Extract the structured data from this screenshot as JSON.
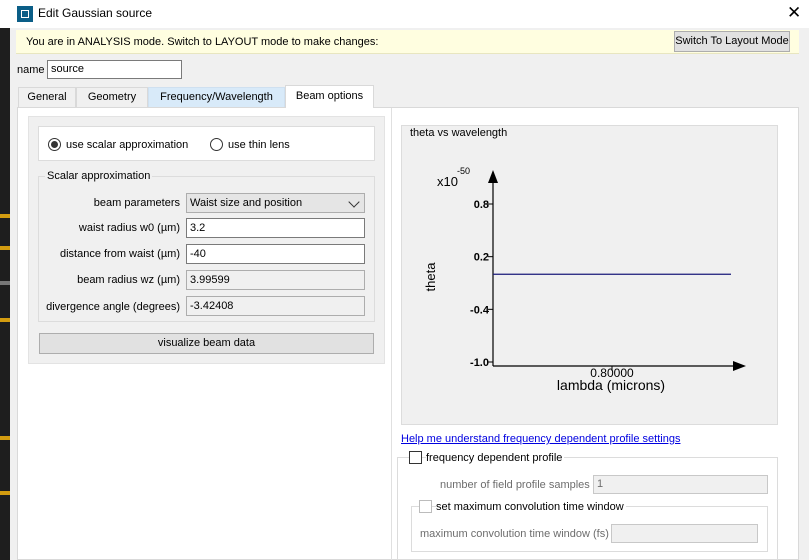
{
  "window": {
    "title": "Edit Gaussian source"
  },
  "infobar": {
    "message": "You are in ANALYSIS mode.  Switch to LAYOUT mode to make changes:",
    "switch_button": "Switch To Layout Mode"
  },
  "name_field": {
    "label": "name",
    "value": "source"
  },
  "tabs": [
    {
      "label": "General"
    },
    {
      "label": "Geometry"
    },
    {
      "label": "Frequency/Wavelength"
    },
    {
      "label": "Beam options"
    }
  ],
  "beam_options": {
    "radios": [
      {
        "label": "use scalar approximation",
        "checked": true
      },
      {
        "label": "use thin lens",
        "checked": false
      }
    ],
    "scalar_group": {
      "title": "Scalar approximation",
      "beam_parameters": {
        "label": "beam parameters",
        "value": "Waist size and position"
      },
      "waist_radius": {
        "label": "waist radius w0 (µm)",
        "value": "3.2"
      },
      "distance_from_waist": {
        "label": "distance from waist (µm)",
        "value": "-40"
      },
      "beam_radius": {
        "label": "beam radius wz (µm)",
        "value": "3.99599"
      },
      "divergence_angle": {
        "label": "divergence angle (degrees)",
        "value": "-3.42408"
      }
    },
    "visualize_button": "visualize beam data"
  },
  "chart_data": {
    "type": "line",
    "title": "theta vs wavelength",
    "xlabel": "lambda (microns)",
    "ylabel": "theta",
    "y_multiplier": "x10",
    "y_exponent": "-50",
    "y_ticks": [
      "0.8",
      "0.2",
      "-0.4",
      "-1.0"
    ],
    "x_ticks": [
      "0.80000"
    ],
    "series": [
      {
        "x": [
          0.75,
          0.85
        ],
        "y": [
          0,
          0
        ],
        "color": "#1a1a7a"
      }
    ],
    "colors": {
      "line": "#1a1a7a",
      "axes": "#000000"
    }
  },
  "help_link": "Help me understand frequency dependent profile settings",
  "frequency_profile": {
    "checkbox_label": "frequency dependent profile",
    "checked": false,
    "samples_label": "number of field profile samples",
    "samples_value": "1",
    "conv_checkbox_label": "set maximum convolution time window",
    "conv_label": "maximum convolution time window (fs)",
    "conv_value": ""
  }
}
